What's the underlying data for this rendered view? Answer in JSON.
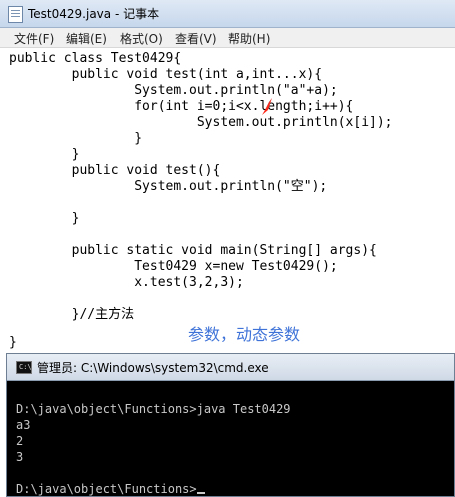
{
  "notepad": {
    "title": "Test0429.java - 记事本",
    "menu": [
      "文件(F)",
      "编辑(E)",
      "格式(O)",
      "查看(V)",
      "帮助(H)"
    ],
    "code": [
      "public class Test0429{",
      "        public void test(int a,int...x){",
      "                System.out.println(\"a\"+a);",
      "                for(int i=0;i<x.length;i++){",
      "                        System.out.println(x[i]);",
      "                }",
      "        }",
      "        public void test(){",
      "                System.out.println(\"空\");",
      "",
      "        }",
      "",
      "        public static void main(String[] args){",
      "                Test0429 x=new Test0429();",
      "                x.test(3,2,3);",
      "",
      "        }//主方法",
      "}"
    ],
    "annotation": "参数，动态参数",
    "annotation_color": "#3f73d8"
  },
  "cmd": {
    "title": "管理员: C:\\Windows\\system32\\cmd.exe",
    "icon_text": "C:\\",
    "lines": [
      "",
      "D:\\java\\object\\Functions>java Test0429",
      "a3",
      "2",
      "3",
      "",
      "D:\\java\\object\\Functions>"
    ]
  },
  "icons": [
    "notepad-icon",
    "cmd-icon",
    "red-pen-arrow-icon"
  ]
}
